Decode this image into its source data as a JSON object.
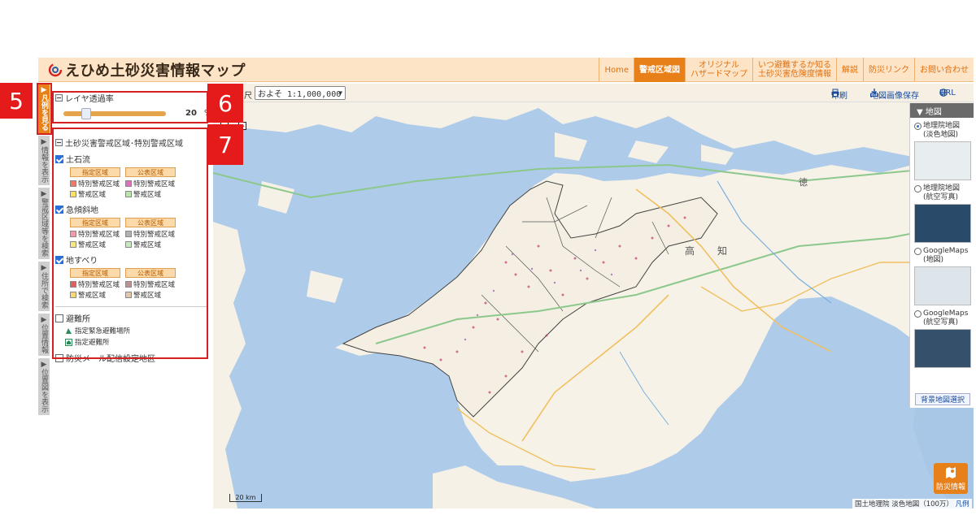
{
  "header": {
    "site_title": "えひめ土砂災害情報マップ",
    "nav": [
      {
        "label": "Home",
        "active": false
      },
      {
        "label": "警戒区域図",
        "active": true
      },
      {
        "label": "オリジナル\nハザードマップ",
        "active": false
      },
      {
        "label": "いつ避難するか知る\n土砂災害危険度情報",
        "active": false
      },
      {
        "label": "解説",
        "active": false
      },
      {
        "label": "防災リンク",
        "active": false
      },
      {
        "label": "お問い合わせ",
        "active": false
      }
    ]
  },
  "side_tabs": [
    {
      "label": "▶凡例を見る",
      "active": true
    },
    {
      "label": "▶情報を表示",
      "active": false
    },
    {
      "label": "▶警戒区域等を検索",
      "active": false
    },
    {
      "label": "▶住所で検索",
      "active": false
    },
    {
      "label": "▶位置情報",
      "active": false
    },
    {
      "label": "▶位置図を表示",
      "active": false
    }
  ],
  "callouts": {
    "c5": "5",
    "c6": "6",
    "c7": "7"
  },
  "legend": {
    "opacity_title": "レイヤ透過率",
    "opacity_value": "20",
    "opacity_unit": "%",
    "opacity_fraction": 0.2,
    "zones_title": "土砂災害警戒区域･特別警戒区域",
    "categories": [
      {
        "label": "土石流",
        "checked": true,
        "head_designated": "指定区域",
        "head_public": "公表区域",
        "items": [
          {
            "label": "特別警戒区域",
            "color": "#f07a6a"
          },
          {
            "label": "特別警戒区域",
            "color": "#e070c0"
          },
          {
            "label": "警戒区域",
            "color": "#f8e060"
          },
          {
            "label": "警戒区域",
            "color": "#b8e8a8"
          }
        ]
      },
      {
        "label": "急傾斜地",
        "checked": true,
        "head_designated": "指定区域",
        "head_public": "公表区域",
        "items": [
          {
            "label": "特別警戒区域",
            "color": "#f49aa8"
          },
          {
            "label": "特別警戒区域",
            "color": "#b0b0b8"
          },
          {
            "label": "警戒区域",
            "color": "#f8e888"
          },
          {
            "label": "警戒区域",
            "color": "#c8e8c0"
          }
        ]
      },
      {
        "label": "地すべり",
        "checked": true,
        "head_designated": "指定区域",
        "head_public": "公表区域",
        "items": [
          {
            "label": "特別警戒区域",
            "color": "#e06060"
          },
          {
            "label": "特別警戒区域",
            "color": "#c09090"
          },
          {
            "label": "警戒区域",
            "color": "#f8d878"
          },
          {
            "label": "警戒区域",
            "color": "#e0c8a8"
          }
        ]
      }
    ],
    "shelter_label": "避難所",
    "shelter_checked": false,
    "shelter_sub": [
      "指定緊急避難場所",
      "指定避難所"
    ],
    "mail_label": "防災メール配信設定地区",
    "mail_checked": false
  },
  "map": {
    "scale_label": "尺",
    "scale_value": "およそ 1:1,000,000",
    "print_label": "印刷",
    "save_label": "地図画像保存",
    "url_label": "URL",
    "scalebar_label": "20 km",
    "region_labels": [
      "高",
      "知",
      "徳"
    ],
    "attribution_main": "国土地理院 淡色地図（100万）",
    "attribution_link": "凡例",
    "disaster_button": "防災情報"
  },
  "basemap": {
    "header": "▼ 地図",
    "options": [
      {
        "label": "地理院地図\n(淡色地図)",
        "selected": true,
        "color": "#e8eef0"
      },
      {
        "label": "地理院地図\n(航空写真)",
        "selected": false,
        "color": "#2a4a6a"
      },
      {
        "label": "GoogleMaps\n(地図)",
        "selected": false,
        "color": "#dde4ea"
      },
      {
        "label": "GoogleMaps\n(航空写真)",
        "selected": false,
        "color": "#34506a"
      }
    ],
    "select_button": "背景地図選択"
  }
}
